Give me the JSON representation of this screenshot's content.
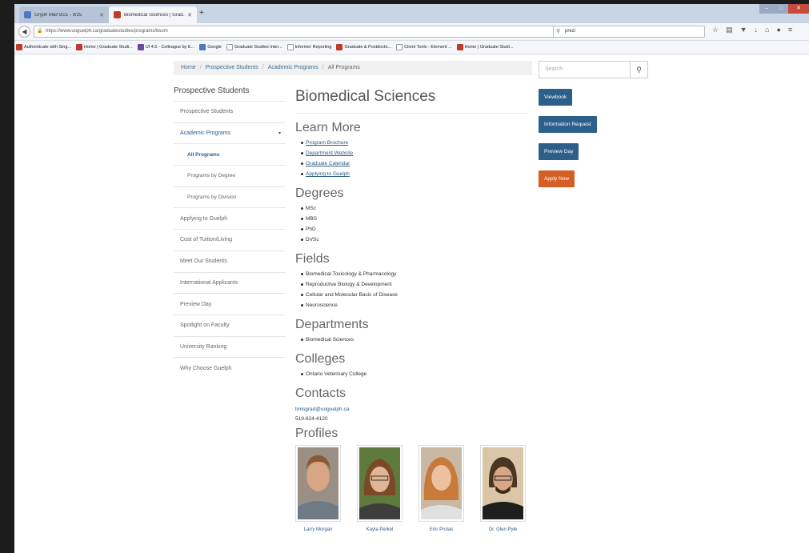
{
  "browser": {
    "tabs": [
      {
        "label": "Gryph Mail 9/21 - 9/25",
        "color": "#4a78c2"
      },
      {
        "label": "Biomedical Sciences | Grad...",
        "color": "#c0392b"
      }
    ],
    "url": "https://www.uoguelph.ca/graduatestudies/programs/bsom",
    "search_value": "prezi",
    "bookmarks": [
      {
        "label": "Authenticate with Sing...",
        "color": "#c0392b"
      },
      {
        "label": "Home | Graduate Studi...",
        "color": "#c0392b"
      },
      {
        "label": "UI 4.5 - Colleague by E...",
        "color": "#6a4aa0"
      },
      {
        "label": "Google",
        "color": "#4a78c2"
      },
      {
        "label": "Graduate Studies Inter...",
        "color": "#ffffff"
      },
      {
        "label": "Informer Reporting",
        "color": "#ffffff"
      },
      {
        "label": "Graduate & Postdocto...",
        "color": "#c0392b"
      },
      {
        "label": "Client Tools - Element ...",
        "color": "#ffffff"
      },
      {
        "label": "Home | Graduate Studi...",
        "color": "#c0392b"
      }
    ]
  },
  "breadcrumb": [
    "Home",
    "Prospective Students",
    "Academic Programs",
    "All Programs"
  ],
  "sidebar": {
    "title": "Prospective Students",
    "items": [
      {
        "label": "Prospective Students"
      },
      {
        "label": "Academic Programs"
      },
      {
        "label": "All Programs"
      },
      {
        "label": "Programs by Degree"
      },
      {
        "label": "Programs by Division"
      },
      {
        "label": "Applying to Guelph"
      },
      {
        "label": "Cost of Tuition/Living"
      },
      {
        "label": "Meet Our Students"
      },
      {
        "label": "International Applicants"
      },
      {
        "label": "Preview Day"
      },
      {
        "label": "Spotlight on Faculty"
      },
      {
        "label": "University Ranking"
      },
      {
        "label": "Why Choose Guelph"
      }
    ]
  },
  "main": {
    "title": "Biomedical Sciences",
    "learn_more": {
      "heading": "Learn More",
      "links": [
        "Program Brochure",
        "Department Website",
        "Graduate Calendar",
        "Applying to Guelph"
      ]
    },
    "degrees": {
      "heading": "Degrees",
      "items": [
        "MSc",
        "MBS",
        "PhD",
        "DVSc"
      ]
    },
    "fields": {
      "heading": "Fields",
      "items": [
        "Biomedical Toxicology & Pharmacology",
        "Reproductive Biology & Development",
        "Cellular and Molecular Basis of Disease",
        "Neuroscience"
      ]
    },
    "departments": {
      "heading": "Departments",
      "items": [
        "Biomedical Sciences"
      ]
    },
    "colleges": {
      "heading": "Colleges",
      "items": [
        "Ontario Veterinary College"
      ]
    },
    "contacts": {
      "heading": "Contacts",
      "email": "bmsgrad@uoguelph.ca",
      "phone": "519-824-4120"
    },
    "profiles": {
      "heading": "Profiles",
      "people": [
        {
          "name": "Larry Morgan"
        },
        {
          "name": "Kayla Perkel"
        },
        {
          "name": "Erin Prolas"
        },
        {
          "name": "Dr. Glen Pyle"
        }
      ]
    }
  },
  "right": {
    "search_placeholder": "Search",
    "buttons": {
      "viewbook": "Viewbook",
      "info": "Information Request",
      "preview": "Preview Day",
      "apply": "Apply Now"
    },
    "colors": {
      "primary": "#2d5f8b",
      "apply": "#d45f24"
    }
  }
}
